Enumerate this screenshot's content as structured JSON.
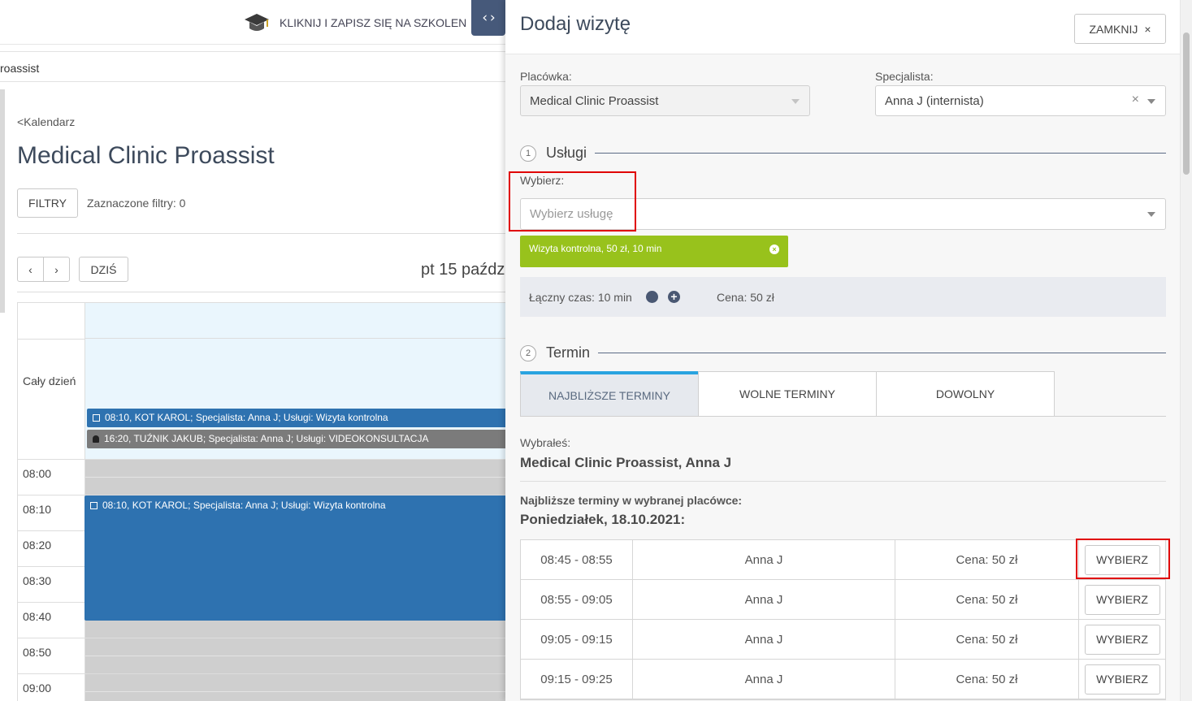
{
  "background": {
    "promo_text": "KLIKNIJ I ZAPISZ SIĘ NA SZKOLEN",
    "subbar_text": "roassist",
    "breadcrumb": "<Kalendarz",
    "clinic_title": "Medical Clinic Proassist",
    "filters_label": "FILTRY",
    "filters_status": "Zaznaczone filtry: 0",
    "prev_icon": "‹",
    "next_icon": "›",
    "today_label": "DZIŚ",
    "date_heading": "pt 15 paźdz",
    "allday_label": "Cały dzień",
    "allday_events": [
      "08:10, KOT KAROL; Specjalista: Anna J; Usługi: Wizyta kontrolna",
      "16:20, TUŹNIK JAKUB; Specjalista: Anna J; Usługi: VIDEOKONSULTACJA"
    ],
    "time_slots": [
      "08:00",
      "08:10",
      "08:20",
      "08:30",
      "08:40",
      "08:50",
      "09:00"
    ],
    "slot_event": "08:10, KOT KAROL; Specjalista: Anna J; Usługi: Wizyta kontrolna",
    "toggle_icon": "‹›"
  },
  "panel": {
    "title": "Dodaj wizytę",
    "close_label": "ZAMKNIJ",
    "close_icon": "×",
    "facility_label": "Placówka:",
    "facility_value": "Medical Clinic Proassist",
    "specialist_label": "Specjalista:",
    "specialist_value": "Anna J (internista)",
    "clear_icon": "×",
    "section1_num": "1",
    "section1_title": "Usługi",
    "choose_label": "Wybierz:",
    "service_placeholder": "Wybierz usługę",
    "selected_service": "Wizyta kontrolna, 50 zł, 10 min",
    "remove_icon": "×",
    "total_time": "Łączny czas: 10 min",
    "plus_icon": "+",
    "total_price": "Cena: 50 zł",
    "section2_num": "2",
    "section2_title": "Termin",
    "tabs": [
      "NAJBLIŻSZE TERMINY",
      "WOLNE TERMINY",
      "DOWOLNY"
    ],
    "chosen_label": "Wybrałeś:",
    "chosen_value": "Medical Clinic Proassist, Anna J",
    "nearest_label": "Najbliższe terminy w wybranej placówce:",
    "day_label": "Poniedziałek, 18.10.2021:",
    "slots": [
      {
        "time": "08:45 - 08:55",
        "doctor": "Anna J",
        "price": "Cena: 50 zł",
        "action": "WYBIERZ"
      },
      {
        "time": "08:55 - 09:05",
        "doctor": "Anna J",
        "price": "Cena: 50 zł",
        "action": "WYBIERZ"
      },
      {
        "time": "09:05 - 09:15",
        "doctor": "Anna J",
        "price": "Cena: 50 zł",
        "action": "WYBIERZ"
      },
      {
        "time": "09:15 - 09:25",
        "doctor": "Anna J",
        "price": "Cena: 50 zł",
        "action": "WYBIERZ"
      }
    ]
  },
  "colors": {
    "accent_blue": "#2e72b0",
    "tag_green": "#98c21c",
    "highlight_red": "#e00000",
    "tab_active_border": "#29a3e0"
  }
}
